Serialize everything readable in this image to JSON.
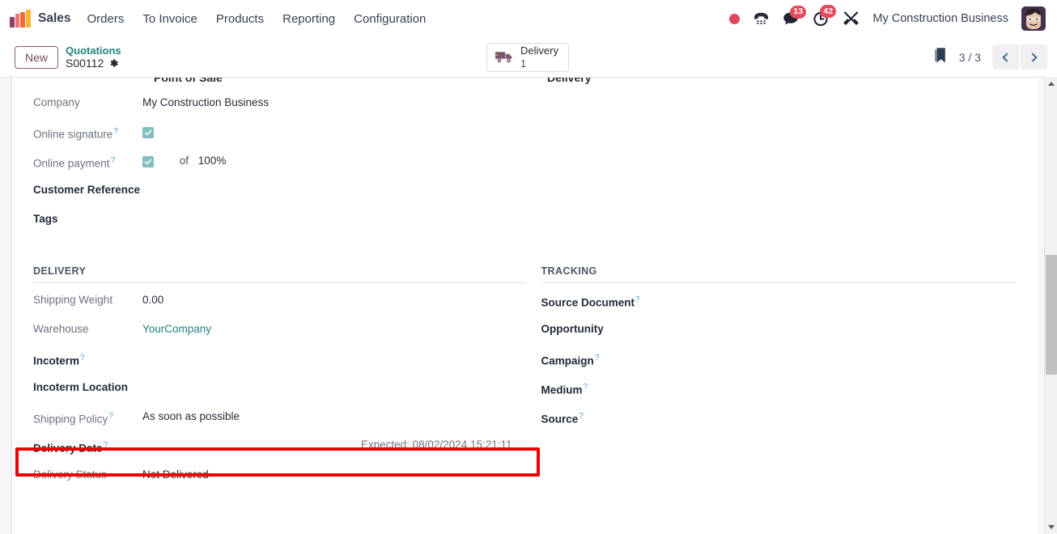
{
  "navbar": {
    "app_name": "Sales",
    "logo_icon": "odoo-bars-logo",
    "menu_items": [
      {
        "label": "Orders",
        "icon": ""
      },
      {
        "label": "To Invoice",
        "icon": ""
      },
      {
        "label": "Products",
        "icon": ""
      },
      {
        "label": "Reporting",
        "icon": ""
      },
      {
        "label": "Configuration",
        "icon": ""
      }
    ],
    "systray": {
      "record_icon": "red-record-dot-icon",
      "phone_icon": "dialpad-phone-icon",
      "messages_icon": "chat-bubble-icon",
      "messages_count": "13",
      "activities_icon": "clock-activity-icon",
      "activities_count": "42",
      "tools_icon": "tools-wrench-icon",
      "company_name": "My Construction Business",
      "avatar_icon": "user-avatar"
    }
  },
  "control_panel": {
    "new_button": "New",
    "breadcrumb_parent": "Quotations",
    "breadcrumb_current": "S00112",
    "settings_icon": "gear-icon",
    "smart_button": {
      "icon": "delivery-truck-icon",
      "label": "Delivery",
      "count": "1"
    },
    "bookmark_icon": "bookmark-icon",
    "pager": "3 / 3",
    "prev_icon": "chevron-left-icon",
    "next_icon": "chevron-right-icon"
  },
  "form": {
    "clipped_left": "Point of Sale",
    "clipped_right": "Delivery",
    "left_fields": [
      {
        "label": "Company",
        "value": "My Construction Business",
        "state": "filled",
        "help": false
      },
      {
        "label": "Online signature",
        "value": "",
        "state": "filled",
        "help": true,
        "type": "checkbox",
        "checked": true
      },
      {
        "label": "Online payment",
        "value": "",
        "state": "filled",
        "help": true,
        "type": "checkbox-percent",
        "checked": true,
        "of_label": "of",
        "percent": "100%"
      },
      {
        "label": "Customer Reference",
        "value": "",
        "state": "empty",
        "help": false
      },
      {
        "label": "Tags",
        "value": "",
        "state": "empty",
        "help": false
      }
    ],
    "delivery_section": {
      "title": "DELIVERY",
      "fields": [
        {
          "label": "Shipping Weight",
          "value": "0.00",
          "state": "filled",
          "help": false
        },
        {
          "label": "Warehouse",
          "value": "YourCompany",
          "state": "filled",
          "help": false,
          "link": true
        },
        {
          "label": "Incoterm",
          "value": "",
          "state": "empty",
          "help": true
        },
        {
          "label": "Incoterm Location",
          "value": "",
          "state": "empty",
          "help": false
        },
        {
          "label": "Shipping Policy",
          "value": "As soon as possible",
          "state": "filled",
          "help": true
        },
        {
          "label": "Delivery Date",
          "value": "",
          "state": "empty",
          "help": true,
          "expected": "Expected: 08/02/2024 15:21:11",
          "highlighted": true
        },
        {
          "label": "Delivery Status",
          "value": "Not Delivered",
          "state": "filled",
          "help": false
        }
      ]
    },
    "tracking_section": {
      "title": "TRACKING",
      "fields": [
        {
          "label": "Source Document",
          "value": "",
          "state": "empty",
          "help": true
        },
        {
          "label": "Opportunity",
          "value": "",
          "state": "empty",
          "help": false
        },
        {
          "label": "Campaign",
          "value": "",
          "state": "empty",
          "help": true
        },
        {
          "label": "Medium",
          "value": "",
          "state": "empty",
          "help": true
        },
        {
          "label": "Source",
          "value": "",
          "state": "empty",
          "help": true
        }
      ]
    },
    "help_marker": "?"
  },
  "colors": {
    "brand_teal": "#23827f",
    "highlight_red": "#ee0000",
    "badge_red": "#e8485e",
    "checkbox_teal": "#82bfc0"
  }
}
